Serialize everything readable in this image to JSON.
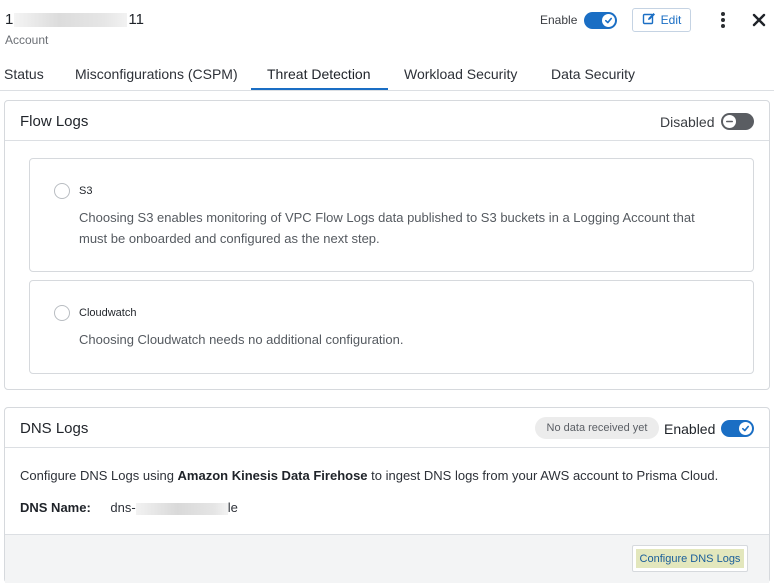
{
  "header": {
    "account_prefix": "1",
    "account_suffix": "11",
    "account_type": "Account",
    "enable_label": "Enable",
    "enable_on": true,
    "edit_label": "Edit"
  },
  "tabs": [
    {
      "label": "Status",
      "active": false
    },
    {
      "label": "Misconfigurations (CSPM)",
      "active": false
    },
    {
      "label": "Threat Detection",
      "active": true
    },
    {
      "label": "Workload Security",
      "active": false
    },
    {
      "label": "Data Security",
      "active": false
    }
  ],
  "flow_logs": {
    "title": "Flow Logs",
    "status_label": "Disabled",
    "enabled": false,
    "options": [
      {
        "title": "S3",
        "desc_line1": "Choosing S3 enables monitoring of VPC Flow Logs data published to S3 buckets in a Logging Account that",
        "desc_line2": "must be onboarded and configured as the next step."
      },
      {
        "title": "Cloudwatch",
        "desc_line1": "Choosing Cloudwatch needs no additional configuration."
      }
    ]
  },
  "dns_logs": {
    "title": "DNS Logs",
    "pill": "No data received yet",
    "status_label": "Enabled",
    "enabled": true,
    "desc_prefix": "Configure DNS Logs using ",
    "desc_bold": "Amazon Kinesis Data Firehose",
    "desc_suffix": " to ingest DNS logs from your AWS account to Prisma Cloud.",
    "name_label": "DNS Name:",
    "name_prefix": "dns-",
    "name_suffix": "le",
    "configure_button": "Configure DNS Logs"
  },
  "colors": {
    "accent": "#1a6ec4",
    "toggle_off": "#5a5d62",
    "highlight": "#e3e7bd"
  }
}
